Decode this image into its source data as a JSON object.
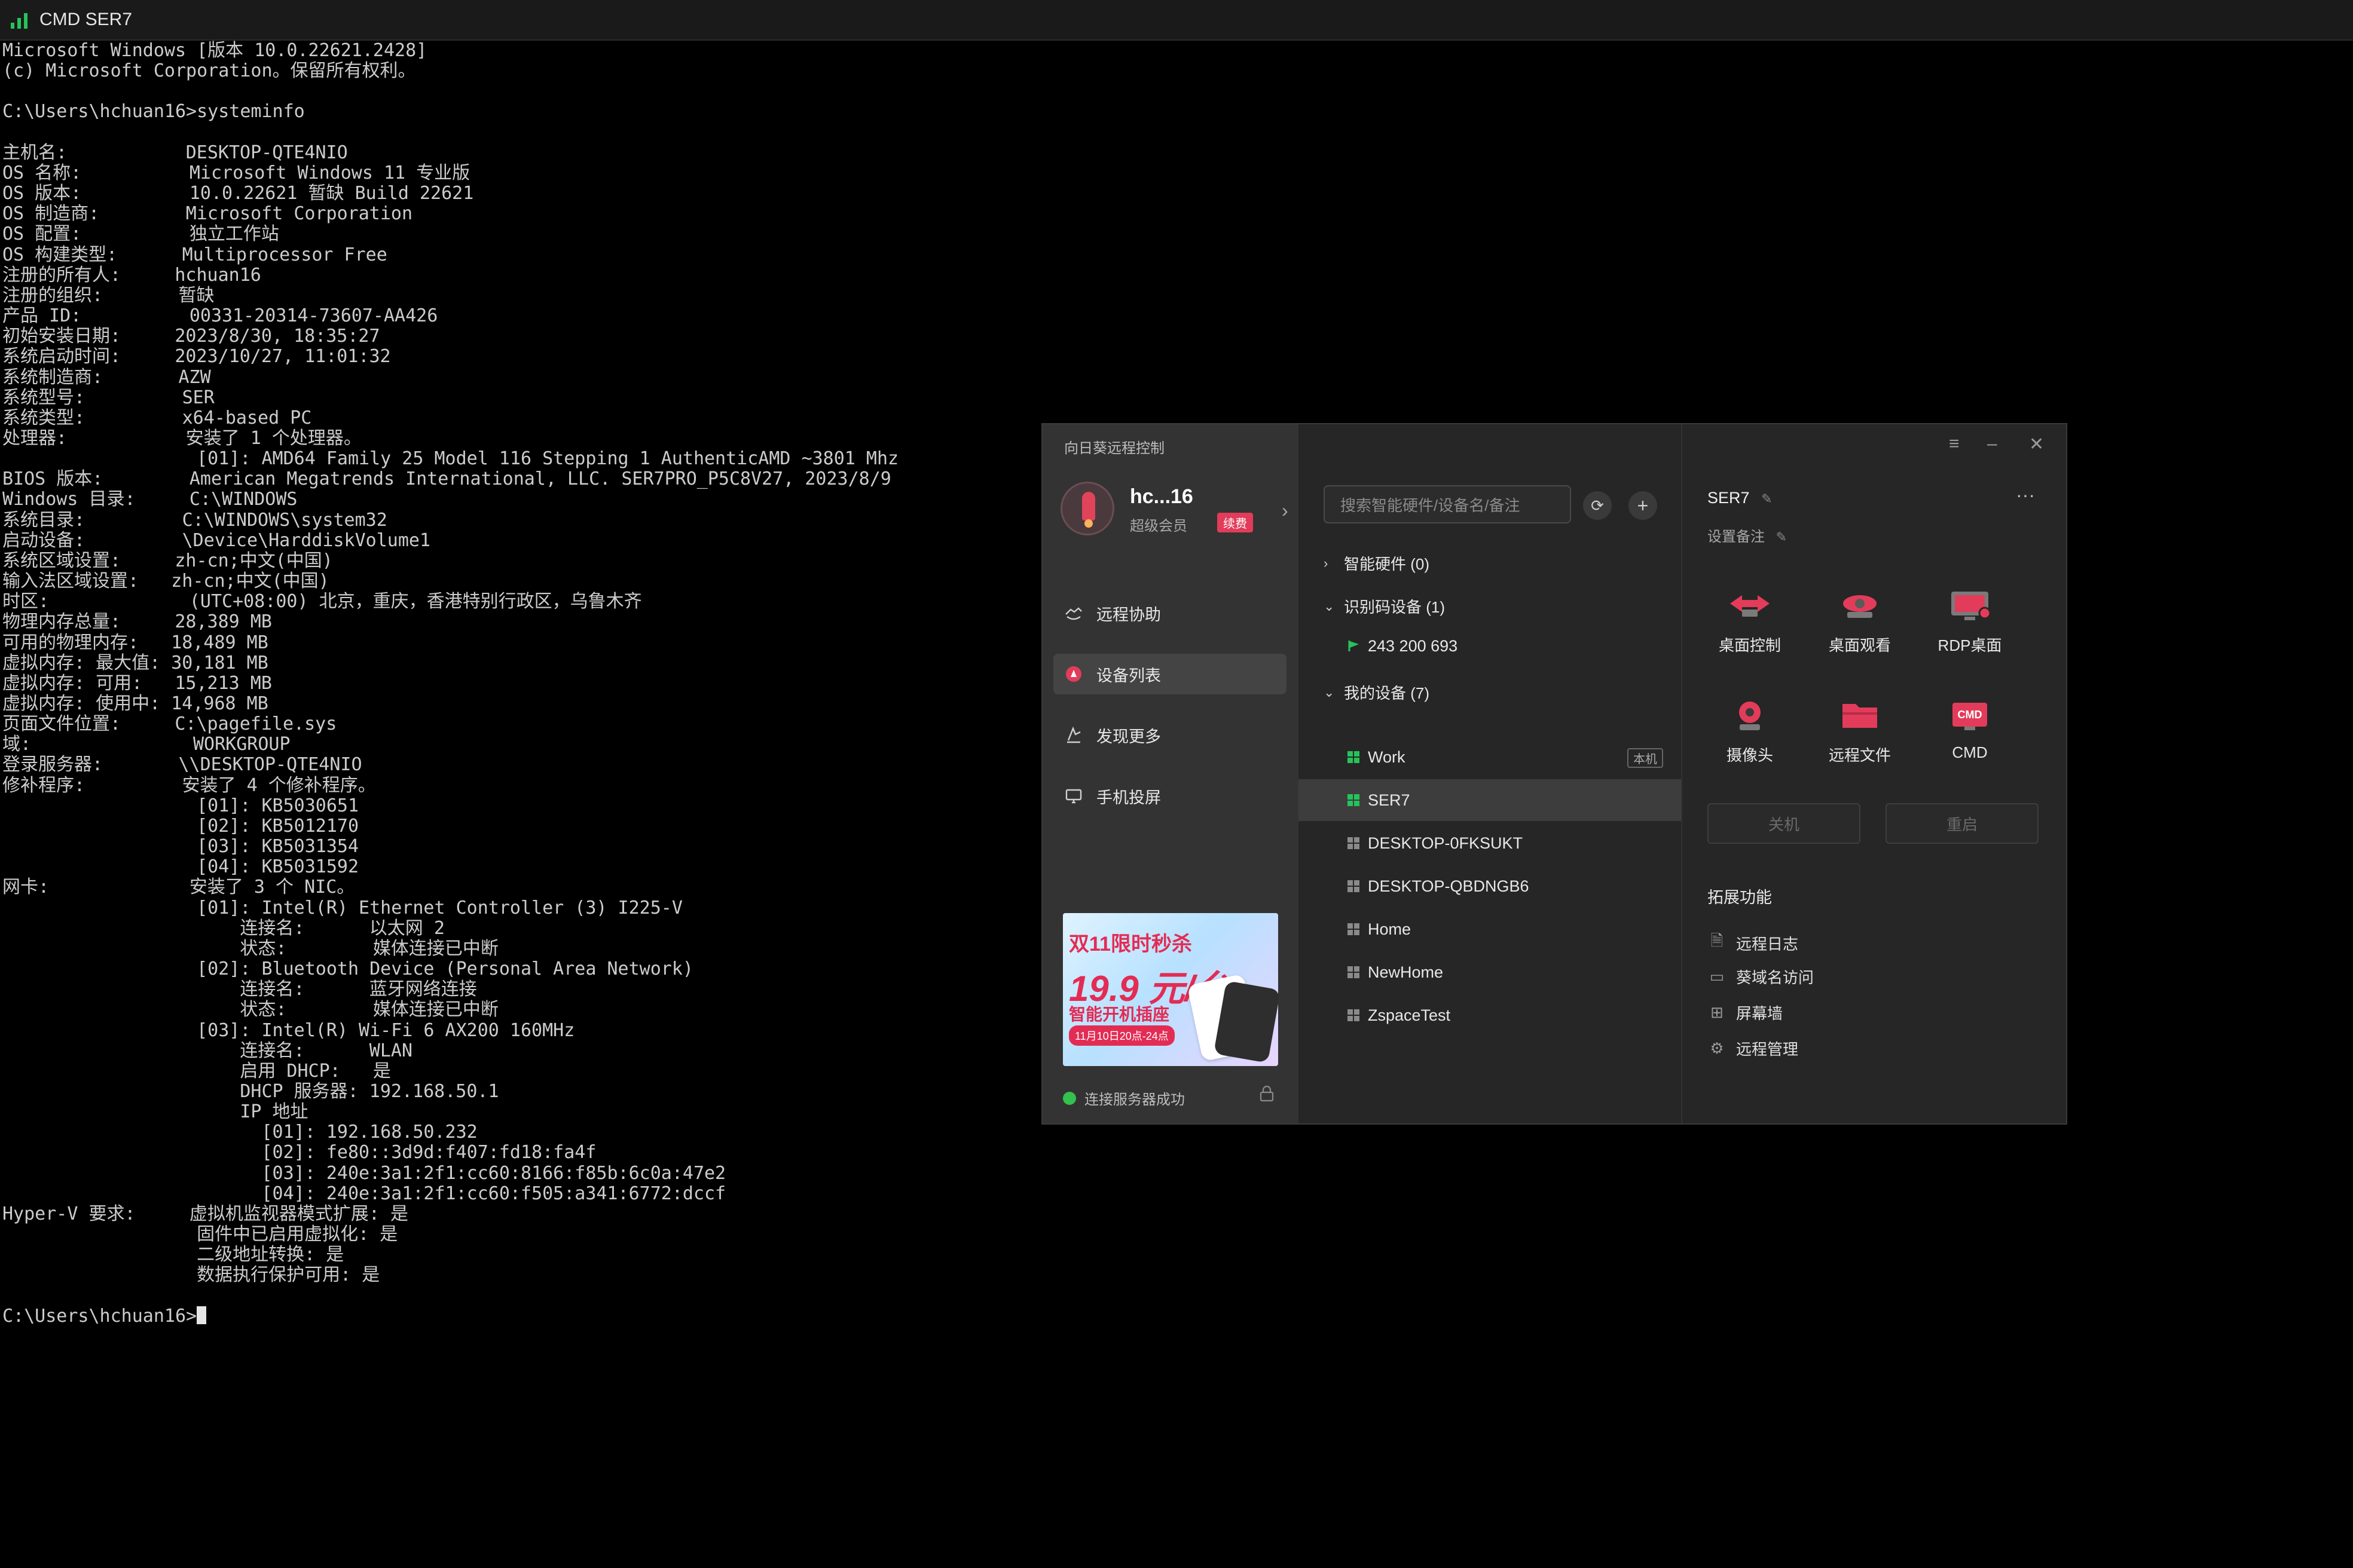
{
  "cmd": {
    "title": "CMD SER7",
    "lines": [
      "Microsoft Windows [版本 10.0.22621.2428]",
      "(c) Microsoft Corporation。保留所有权利。",
      "",
      "C:\\Users\\hchuan16>systeminfo",
      "",
      "主机名:           DESKTOP-QTE4NIO",
      "OS 名称:          Microsoft Windows 11 专业版",
      "OS 版本:          10.0.22621 暂缺 Build 22621",
      "OS 制造商:        Microsoft Corporation",
      "OS 配置:          独立工作站",
      "OS 构建类型:      Multiprocessor Free",
      "注册的所有人:     hchuan16",
      "注册的组织:       暂缺",
      "产品 ID:          00331-20314-73607-AA426",
      "初始安装日期:     2023/8/30, 18:35:27",
      "系统启动时间:     2023/10/27, 11:01:32",
      "系统制造商:       AZW",
      "系统型号:         SER",
      "系统类型:         x64-based PC",
      "处理器:           安装了 1 个处理器。",
      "                  [01]: AMD64 Family 25 Model 116 Stepping 1 AuthenticAMD ~3801 Mhz",
      "BIOS 版本:        American Megatrends International, LLC. SER7PRO_P5C8V27, 2023/8/9",
      "Windows 目录:     C:\\WINDOWS",
      "系统目录:         C:\\WINDOWS\\system32",
      "启动设备:         \\Device\\HarddiskVolume1",
      "系统区域设置:     zh-cn;中文(中国)",
      "输入法区域设置:   zh-cn;中文(中国)",
      "时区:             (UTC+08:00) 北京，重庆，香港特别行政区，乌鲁木齐",
      "物理内存总量:     28,389 MB",
      "可用的物理内存:   18,489 MB",
      "虚拟内存: 最大值: 30,181 MB",
      "虚拟内存: 可用:   15,213 MB",
      "虚拟内存: 使用中: 14,968 MB",
      "页面文件位置:     C:\\pagefile.sys",
      "域:               WORKGROUP",
      "登录服务器:       \\\\DESKTOP-QTE4NIO",
      "修补程序:         安装了 4 个修补程序。",
      "                  [01]: KB5030651",
      "                  [02]: KB5012170",
      "                  [03]: KB5031354",
      "                  [04]: KB5031592",
      "网卡:             安装了 3 个 NIC。",
      "                  [01]: Intel(R) Ethernet Controller (3) I225-V",
      "                      连接名:      以太网 2",
      "                      状态:        媒体连接已中断",
      "                  [02]: Bluetooth Device (Personal Area Network)",
      "                      连接名:      蓝牙网络连接",
      "                      状态:        媒体连接已中断",
      "                  [03]: Intel(R) Wi-Fi 6 AX200 160MHz",
      "                      连接名:      WLAN",
      "                      启用 DHCP:   是",
      "                      DHCP 服务器: 192.168.50.1",
      "                      IP 地址",
      "                        [01]: 192.168.50.232",
      "                        [02]: fe80::3d9d:f407:fd18:fa4f",
      "                        [03]: 240e:3a1:2f1:cc60:8166:f85b:6c0a:47e2",
      "                        [04]: 240e:3a1:2f1:cc60:f505:a341:6772:dccf",
      "Hyper-V 要求:     虚拟机监视器模式扩展: 是",
      "                  固件中已启用虚拟化: 是",
      "                  二级地址转换: 是",
      "                  数据执行保护可用: 是",
      "",
      "C:\\Users\\hchuan16>"
    ]
  },
  "sunlogin": {
    "app_title": "向日葵远程控制",
    "user": {
      "name": "hc...16",
      "member": "超级会员",
      "renew_badge": "续费"
    },
    "nav": [
      {
        "label": "远程协助",
        "icon": "remote-assist-icon"
      },
      {
        "label": "设备列表",
        "icon": "device-list-icon",
        "active": true
      },
      {
        "label": "发现更多",
        "icon": "discover-icon"
      },
      {
        "label": "手机投屏",
        "icon": "phone-cast-icon"
      }
    ],
    "banner": {
      "line1": "双11限时秒杀",
      "price": "19.9 元/台",
      "line3": "智能开机插座",
      "date": "11月10日20点-24点"
    },
    "status": "连接服务器成功",
    "search_placeholder": "搜索智能硬件/设备名/备注",
    "groups": {
      "smart": "智能硬件 (0)",
      "code": "识别码设备 (1)",
      "code_device": "243 200 693",
      "mine": "我的设备 (7)"
    },
    "devices": [
      {
        "name": "Work",
        "tag": "本机"
      },
      {
        "name": "SER7",
        "active": true
      },
      {
        "name": "DESKTOP-0FKSUKT"
      },
      {
        "name": "DESKTOP-QBDNGB6"
      },
      {
        "name": "Home"
      },
      {
        "name": "NewHome"
      },
      {
        "name": "ZspaceTest"
      }
    ],
    "detail": {
      "title": "SER7",
      "note": "设置备注",
      "functions": [
        "桌面控制",
        "桌面观看",
        "RDP桌面",
        "摄像头",
        "远程文件",
        "CMD"
      ],
      "cmd_badge": "CMD",
      "shutdown": "关机",
      "restart": "重启",
      "ext_title": "拓展功能",
      "ext": [
        "远程日志",
        "葵域名访问",
        "屏幕墙",
        "远程管理"
      ]
    },
    "colors": {
      "accent": "#e23c5a",
      "status_ok": "#33c24d",
      "device_online": "#25c45a"
    }
  }
}
